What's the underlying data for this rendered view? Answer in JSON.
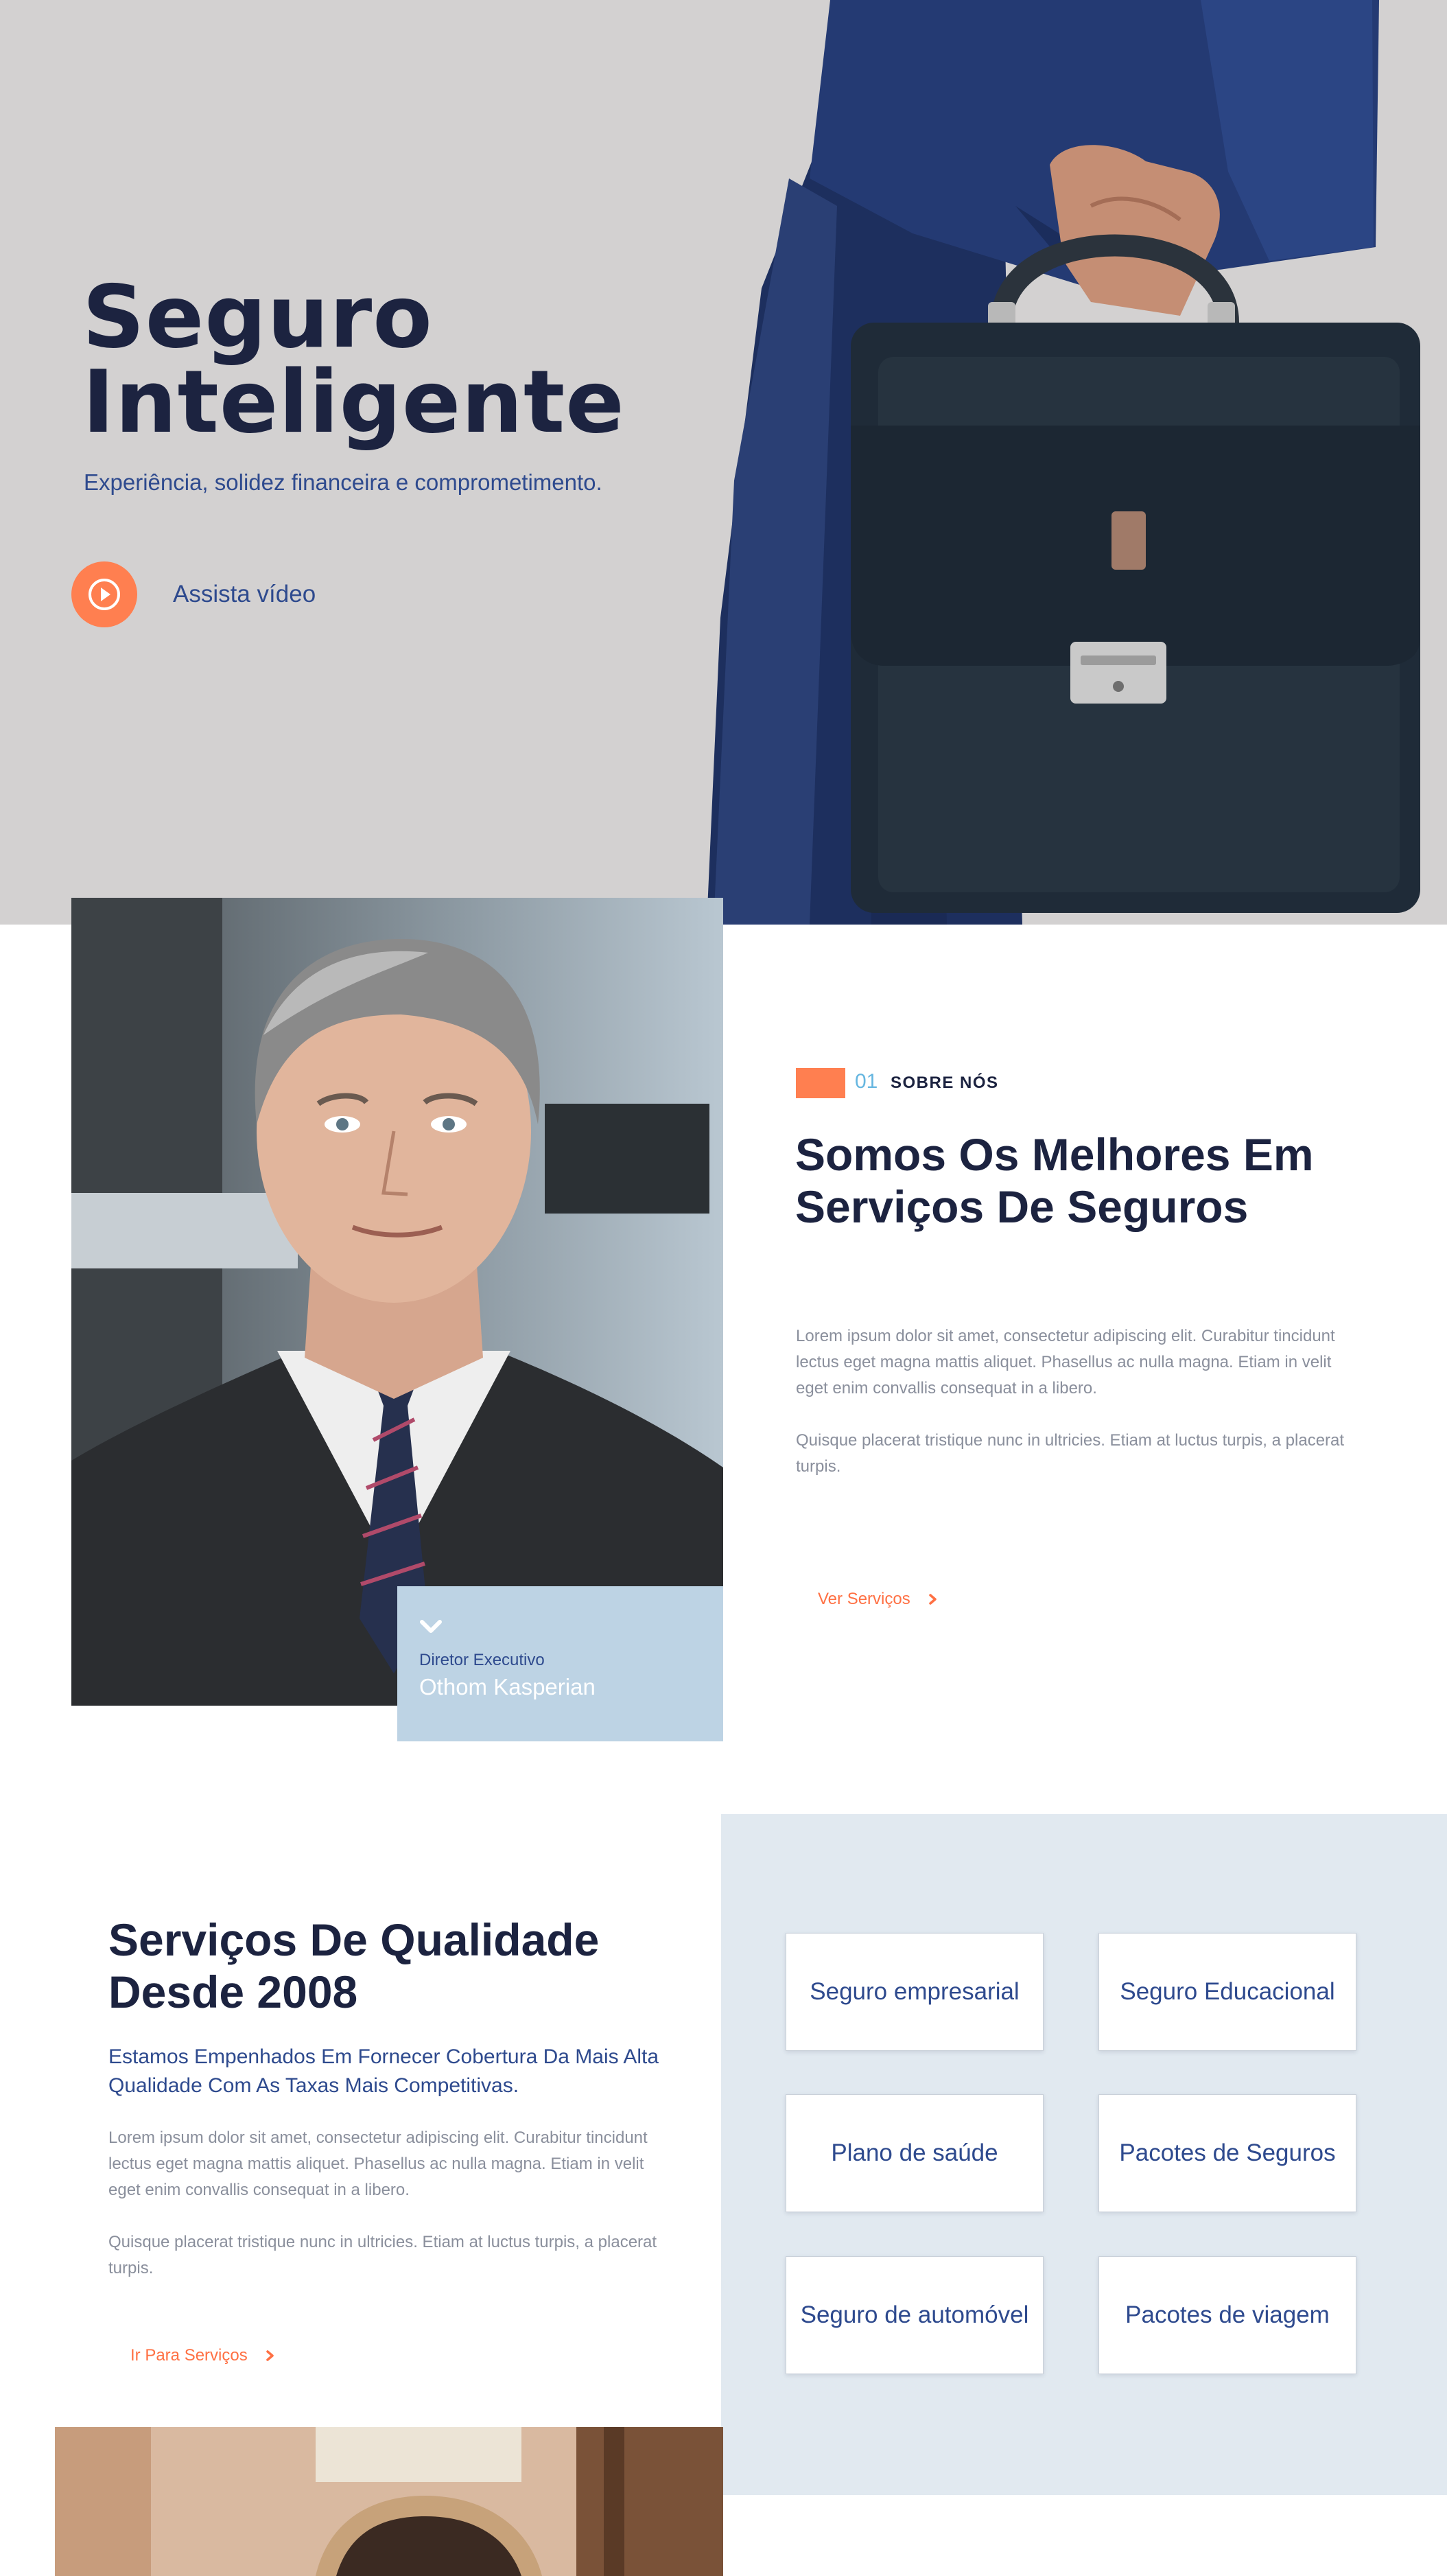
{
  "hero": {
    "title_line1": "Seguro",
    "title_line2": "Inteligente",
    "subtitle": "Experiência, solidez financeira e comprometimento.",
    "video_label": "Assista vídeo"
  },
  "about": {
    "executive_role": "Diretor Executivo",
    "executive_name": "Othom Kasperian",
    "section_number": "01",
    "section_tag": "SOBRE NÓS",
    "heading_line1": "Somos Os Melhores Em",
    "heading_line2": "Serviços De Seguros",
    "paragraph1": "Lorem ipsum dolor sit amet, consectetur adipiscing elit. Curabitur tincidunt lectus eget magna mattis aliquet. Phasellus ac nulla magna. Etiam in velit eget enim convallis consequat in a libero.",
    "paragraph2": "Quisque placerat tristique nunc in ultricies. Etiam at luctus turpis, a placerat turpis.",
    "link_label": "Ver Serviços"
  },
  "services": {
    "heading_line1": "Serviços De Qualidade",
    "heading_line2": "Desde 2008",
    "lead": "Estamos Empenhados Em Fornecer Cobertura Da Mais Alta Qualidade Com As Taxas Mais Competitivas.",
    "paragraph1": "Lorem ipsum dolor sit amet, consectetur adipiscing elit. Curabitur tincidunt lectus eget magna mattis aliquet. Phasellus ac nulla magna. Etiam in velit eget enim convallis consequat in a libero.",
    "paragraph2": "Quisque placerat tristique nunc in ultricies. Etiam at luctus turpis, a placerat turpis.",
    "link_label": "Ir Para Serviços",
    "cards": [
      "Seguro empresarial",
      "Seguro Educacional",
      "Plano de saúde",
      "Pacotes de Seguros",
      "Seguro de automóvel",
      "Pacotes de viagem"
    ]
  },
  "colors": {
    "accent": "#ff7f50",
    "navy": "#1c2340",
    "blue": "#2e4a8e",
    "light_blue": "#66b6e0",
    "card_blue": "#bdd3e4",
    "panel_bg": "#e1e9f0",
    "hero_bg": "#d3d1d1"
  },
  "icons": {
    "play": "play-circle-icon",
    "chevron_down": "chevron-down-icon",
    "chevron_right": "chevron-right-icon"
  }
}
